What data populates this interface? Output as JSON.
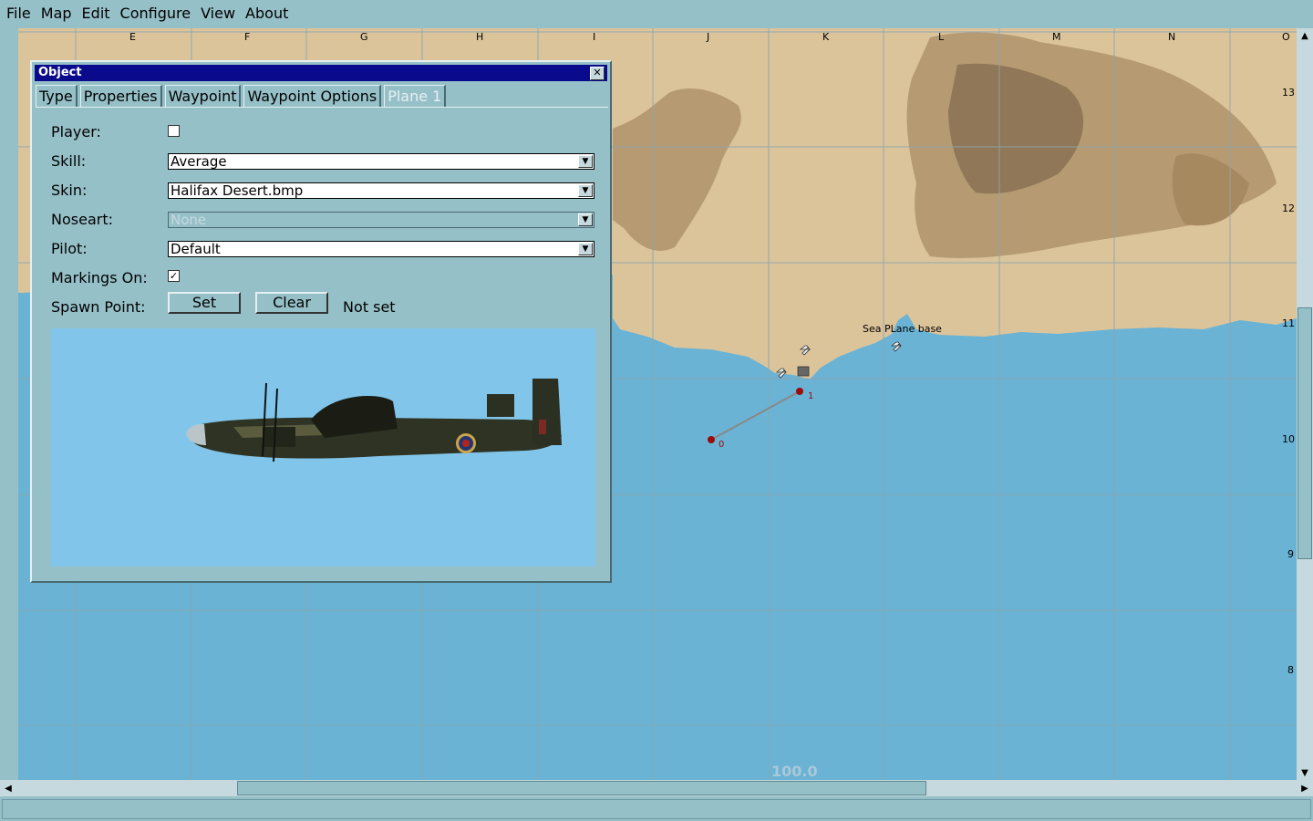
{
  "menu": [
    "File",
    "Map",
    "Edit",
    "Configure",
    "View",
    "About"
  ],
  "map": {
    "columns": [
      "E",
      "F",
      "G",
      "H",
      "I",
      "J",
      "K",
      "L",
      "M",
      "N",
      "O"
    ],
    "rows": [
      "13",
      "12",
      "11",
      "10",
      "9",
      "8"
    ],
    "location_label": "Sea PLane base",
    "waypoints": [
      "0",
      "1"
    ],
    "scale_label": "100.0",
    "sea_color": "#6ab3d4",
    "land_color": "#dcc49a"
  },
  "dialog": {
    "title": "Object",
    "tabs": [
      "Type",
      "Properties",
      "Waypoint",
      "Waypoint Options",
      "Plane 1"
    ],
    "active_tab": "Plane 1",
    "labels": {
      "player": "Player:",
      "skill": "Skill:",
      "skin": "Skin:",
      "noseart": "Noseart:",
      "pilot": "Pilot:",
      "markings": "Markings On:",
      "spawn": "Spawn Point:"
    },
    "values": {
      "player_checked": false,
      "skill": "Average",
      "skin": "Halifax Desert.bmp",
      "noseart": "None",
      "pilot": "Default",
      "markings_checked": true,
      "spawn_status": "Not set"
    },
    "buttons": {
      "set": "Set",
      "clear": "Clear"
    }
  }
}
